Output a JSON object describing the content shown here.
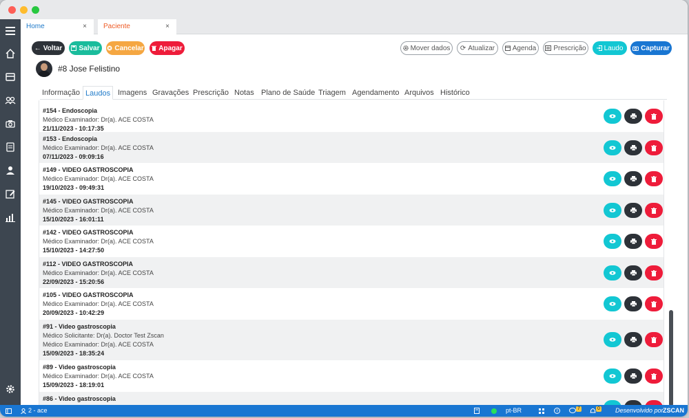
{
  "tabs": [
    {
      "label": "Home",
      "close": "×"
    },
    {
      "label": "Paciente",
      "close": "×"
    }
  ],
  "toolbar": {
    "back_label": "Voltar",
    "save_label": "Salvar",
    "cancel_label": "Cancelar",
    "delete_label": "Apagar",
    "move_label": "Mover dados",
    "refresh_label": "Atualizar",
    "agenda_label": "Agenda",
    "prescription_label": "Prescrição",
    "report_label": "Laudo",
    "capture_label": "Capturar"
  },
  "patient": {
    "name": "#8 Jose Felistino"
  },
  "navtabs": [
    "Informação",
    "Laudos",
    "Imagens",
    "Gravações",
    "Prescrição",
    "Notas",
    "Plano de Saúde",
    "Triagem",
    "Agendamento",
    "Arquivos",
    "Histórico"
  ],
  "reports": [
    {
      "title": "#154 - Endoscopia",
      "lines": [
        "Médico Examinador: Dr(a). ACE COSTA"
      ],
      "date": "21/11/2023 - 10:17:35"
    },
    {
      "title": "#153 - Endoscopia",
      "lines": [
        "Médico Examinador: Dr(a). ACE COSTA"
      ],
      "date": "07/11/2023 - 09:09:16"
    },
    {
      "title": "#149 - VIDEO GASTROSCOPIA",
      "lines": [
        "Médico Examinador: Dr(a). ACE COSTA"
      ],
      "date": "19/10/2023 - 09:49:31"
    },
    {
      "title": "#145 - VIDEO GASTROSCOPIA",
      "lines": [
        "Médico Examinador: Dr(a). ACE COSTA"
      ],
      "date": "15/10/2023 - 16:01:11"
    },
    {
      "title": "#142 - VIDEO GASTROSCOPIA",
      "lines": [
        "Médico Examinador: Dr(a). ACE COSTA"
      ],
      "date": "15/10/2023 - 14:27:50"
    },
    {
      "title": "#112 - VIDEO GASTROSCOPIA",
      "lines": [
        "Médico Examinador: Dr(a). ACE COSTA"
      ],
      "date": "22/09/2023 - 15:20:56"
    },
    {
      "title": "#105 - VIDEO GASTROSCOPIA",
      "lines": [
        "Médico Examinador: Dr(a). ACE COSTA"
      ],
      "date": "20/09/2023 - 10:42:29"
    },
    {
      "title": "#91 - Video gastroscopia",
      "lines": [
        "Médico Solicitante: Dr(a). Doctor Test Zscan",
        "Médico Examinador: Dr(a). ACE COSTA"
      ],
      "date": "15/09/2023 - 18:35:24"
    },
    {
      "title": "#89 - Video gastroscopia",
      "lines": [
        "Médico Examinador: Dr(a). ACE COSTA"
      ],
      "date": "15/09/2023 - 18:19:01"
    },
    {
      "title": "#86 - Video gastroscopia",
      "lines": [],
      "date": ""
    }
  ],
  "status": {
    "user": "2 - ace",
    "language": "pt-BR",
    "chat_badge": "7",
    "notif_badge": "0",
    "developed_by": "Desenvolvido por",
    "brand": "ZSCAN"
  },
  "colors": {
    "teal": "#12c7d3",
    "dark": "#2d3238",
    "red": "#ee1c3a",
    "green": "#1abc9c",
    "orange": "#f5a742",
    "blue": "#1976d2"
  }
}
